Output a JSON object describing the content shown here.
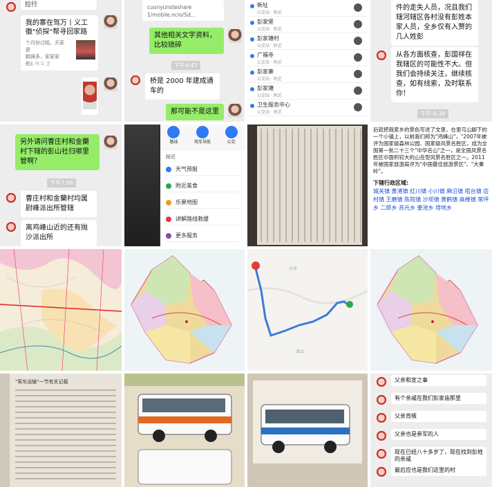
{
  "tile1": {
    "bubble_text": "我的寨在驾万丨义工徽\"侦探\"帮寻回家路",
    "sub_text": "个月份过程，天家是\n鹏姨多，家家家\n在。",
    "footer": "< 大 问 公 卫"
  },
  "tile2": {
    "link_fragment": "cuonyunsteshare\n1/mobile.ncio/Sd...",
    "bubble1": "其他相关文字资料，比较琐碎",
    "time": "下午4:47",
    "bubble2": "桥是 2000 年建成通车的",
    "bubble3": "那可能不是这里"
  },
  "tile3": {
    "items": [
      {
        "title": "新址",
        "sub": "公交站 · 附近"
      },
      {
        "title": "彭家堡",
        "sub": "公交站 · 附近"
      },
      {
        "title": "彭家塘村",
        "sub": "公交站 · 附近"
      },
      {
        "title": "广福寺",
        "sub": "公交站 · 附近"
      },
      {
        "title": "彭家寨",
        "sub": "公交站 · 附近"
      },
      {
        "title": "彭家塘",
        "sub": "公交站 · 附近"
      },
      {
        "title": "卫生服务中心",
        "sub": "公交站 · 附近"
      }
    ]
  },
  "tile4": {
    "bubble1": "件的走失人员，况且我们辖河辖区各村没有彭姓本家人员，全乡仅有入赘的几人姓彭",
    "bubble2": "从各方面核查，彭国祥在我辖区的可能性不大。但我们会持续关注，继续核查，如有线索，及时联系你！",
    "time": "下午 6:38"
  },
  "tile5": {
    "bubble1": "另外请问曹庄村和金蘭村下辖的彭山社归哪里管啊？",
    "time": "下午7:06",
    "bubble2": "曹庄村和金蘭村均属尉峰派出所管辖",
    "bubble3": "离鸡峰山近的还有抛沙派出所"
  },
  "tile6": {
    "buttons": [
      "路线",
      "驾车导航",
      "公交"
    ],
    "heading": "附近",
    "items": [
      "天气预报",
      "附近美食",
      "乐果地图",
      "讲解路线救援",
      "更多服务"
    ]
  },
  "tile7": {},
  "tile8": {
    "para": "后就把我家乡的景色写进了文里，在里弓山脚下的一个小镇上，以前我们称为\"鸡峰山\"，\"2007年被评为国家级森林公园、国家级风景名胜区，成为全国第一批二十三个\"中华名山\"之一，是全国风景名胜区中面积较大的山岳型风景名胜区之一。2011年被国家旅游局评为\"中国最佳旅游景区\"、\"大秦岭\"。",
    "section_title": "下辖行政区域:",
    "towns": "城关镇 黄渚镇 红川镇 小川镇 麻沿镇 咀台镇 店村镇 王磨镇 陈院镇 沙坝镇 黄鹤镇 高楼镇 荣坪乡 二郎乡 苏元乡 姜池乡 塔地乡"
  },
  "tile11": {
    "label1": "小沙",
    "label2": "龙山"
  },
  "tile13": {
    "heading": "\"客车运输\"一节有关记载"
  },
  "tile16": {
    "bubbles": [
      "父亲和宣之事",
      "有个亲戚在我们彭家庙那里",
      "父亲背叛",
      "父亲也是参军的人",
      "现在已经八十多岁了，现在找到彭姓的亲戚",
      "最后应也是我们这里的村"
    ]
  }
}
